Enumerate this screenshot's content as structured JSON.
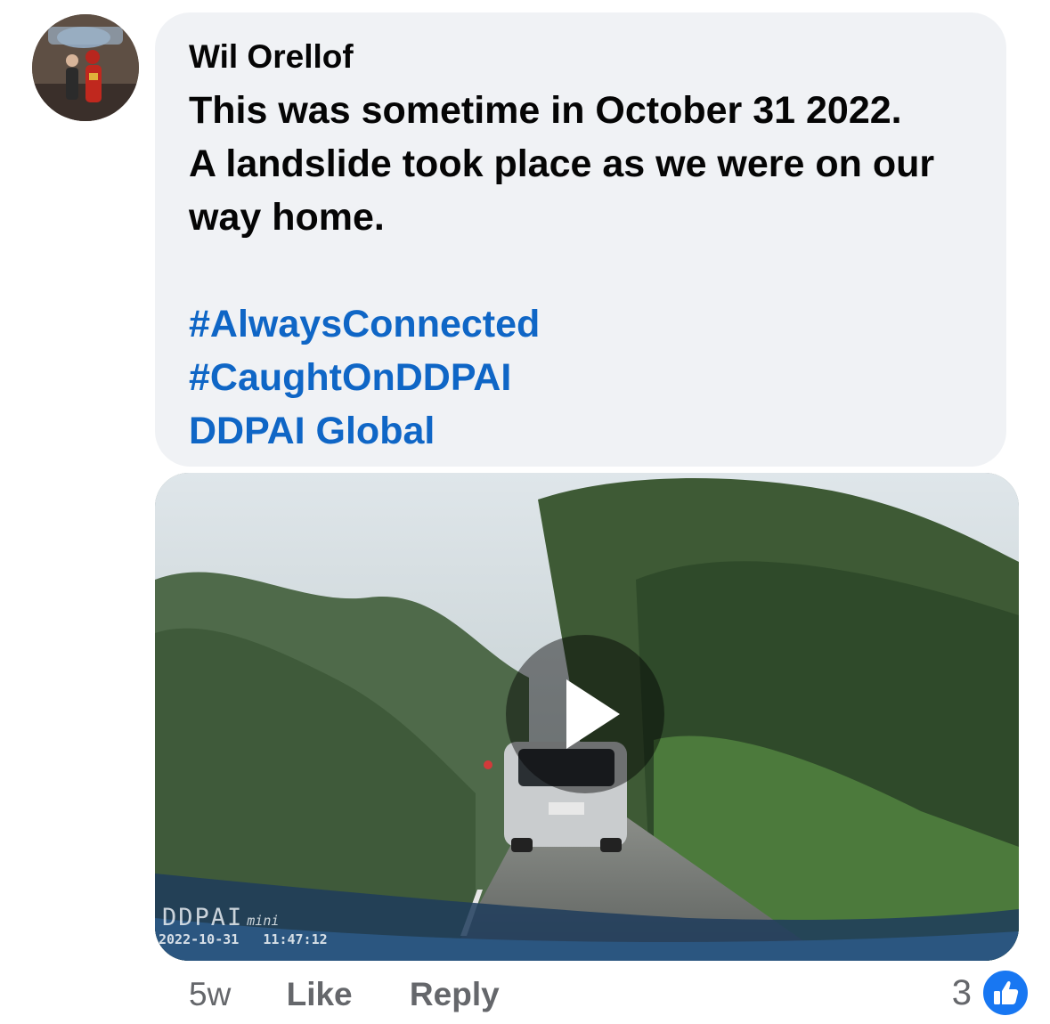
{
  "comment": {
    "author": "Wil Orellof",
    "text_lines": [
      "This was sometime in October 31 2022.",
      "A landslide took place as we were on our",
      "way home."
    ],
    "hashtags": [
      "#AlwaysConnected",
      "#CaughtOnDDPAI"
    ],
    "mention": "DDPAI Global"
  },
  "video": {
    "watermark_logo": "DDPAI",
    "watermark_model": "mini",
    "date": "2022-10-31",
    "time": "11:47:12",
    "play_icon": "play-icon"
  },
  "actions": {
    "age": "5w",
    "like_label": "Like",
    "reply_label": "Reply"
  },
  "reactions": {
    "count": "3",
    "icon": "thumbs-up-icon",
    "color": "#1877f2"
  },
  "colors": {
    "link": "#0f66c6",
    "bubble": "#f0f2f5",
    "muted": "#65676b"
  }
}
